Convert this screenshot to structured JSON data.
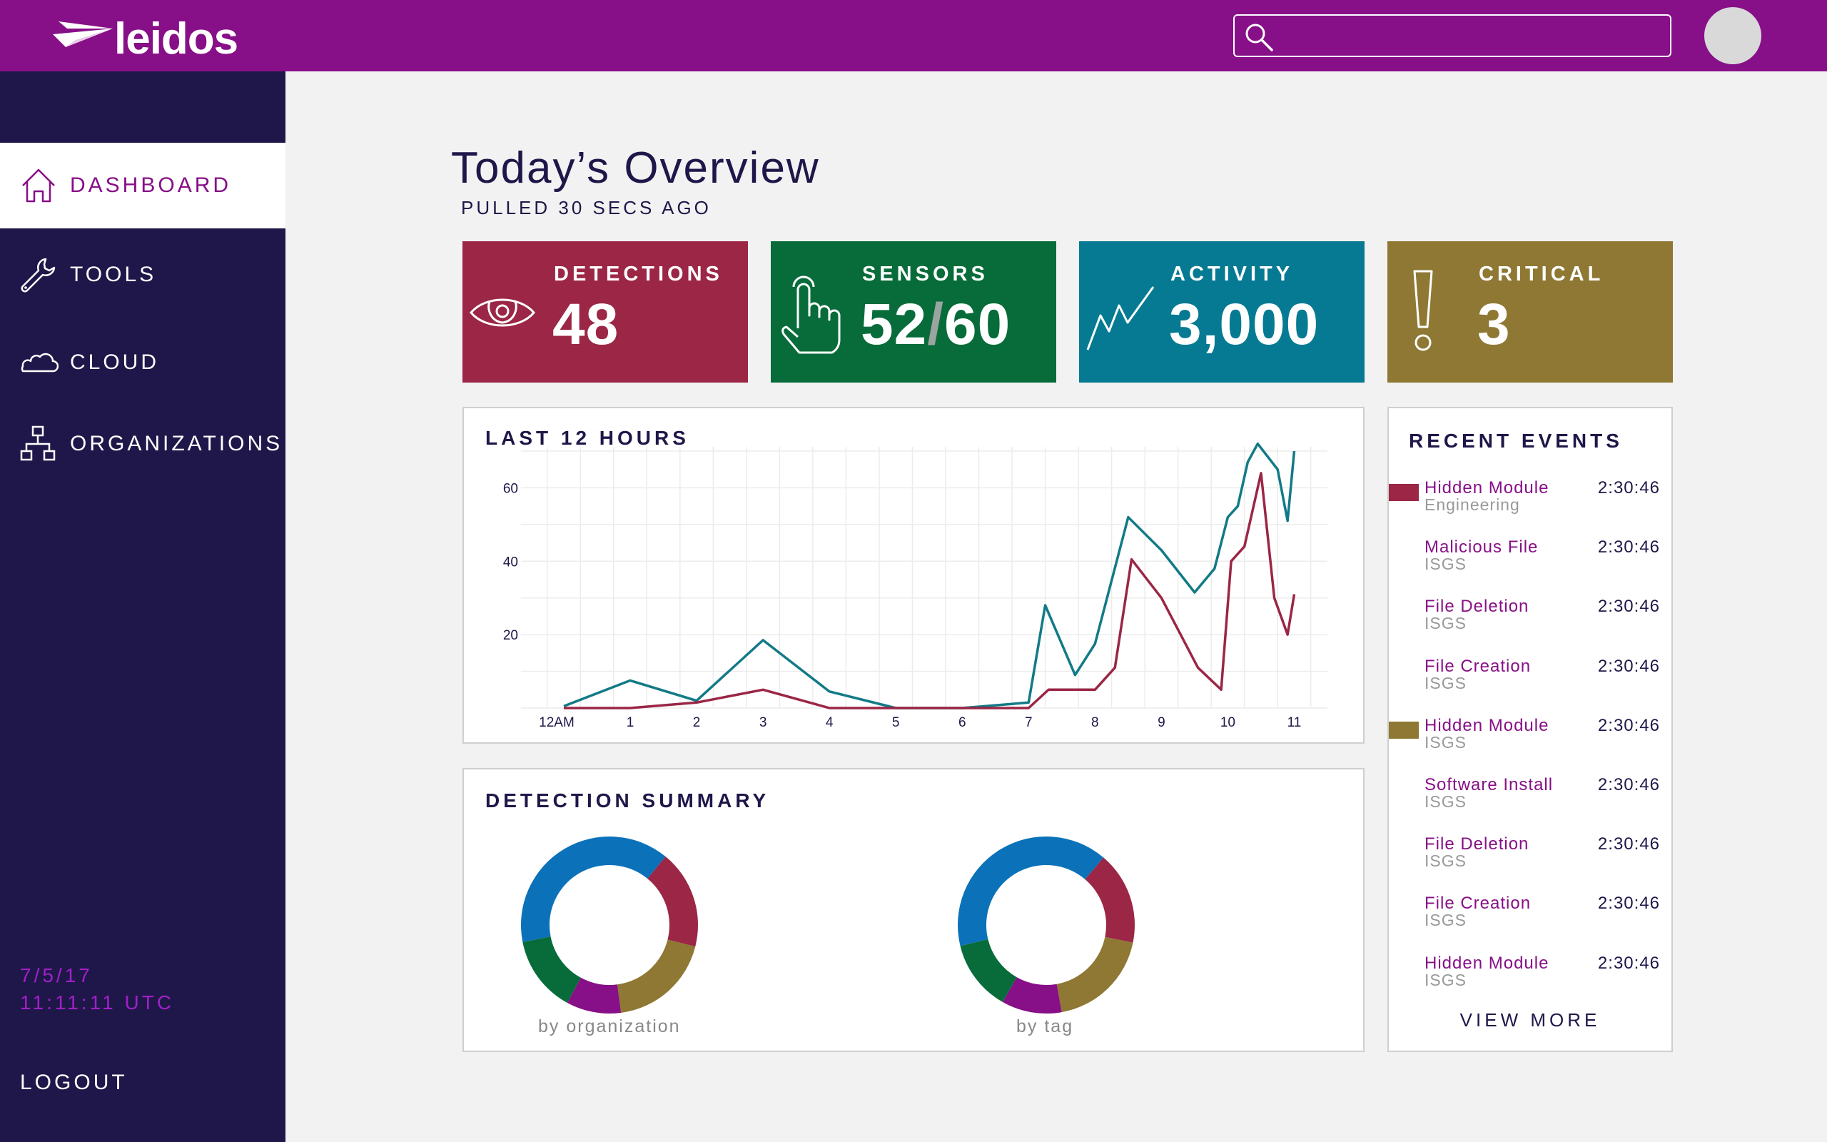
{
  "brand": {
    "name": "leidos"
  },
  "search": {
    "placeholder": ""
  },
  "sidebar": {
    "items": [
      {
        "label": "DASHBOARD",
        "icon": "home-icon"
      },
      {
        "label": "TOOLS",
        "icon": "wrench-icon"
      },
      {
        "label": "CLOUD",
        "icon": "cloud-icon"
      },
      {
        "label": "ORGANIZATIONS",
        "icon": "org-chart-icon"
      }
    ],
    "date": "7/5/17",
    "time": "11:11:11 UTC",
    "logout": "LOGOUT"
  },
  "overview": {
    "title": "Today’s Overview",
    "subtitle": "PULLED 30 SECS AGO"
  },
  "cards": {
    "detections": {
      "label": "DETECTIONS",
      "value": "48",
      "icon": "eye-icon",
      "color": "#9b2645"
    },
    "sensors": {
      "label": "SENSORS",
      "value_a": "52",
      "sep": "/",
      "value_b": "60",
      "icon": "pointer-hand-icon",
      "color": "#076c3a"
    },
    "activity": {
      "label": "ACTIVITY",
      "value": "3,000",
      "icon": "activity-line-icon",
      "color": "#067a92"
    },
    "critical": {
      "label": "CRITICAL",
      "value": "3",
      "icon": "exclamation-icon",
      "color": "#8e7833"
    }
  },
  "chart_panel": {
    "title": "LAST 12 HOURS"
  },
  "chart_data": {
    "type": "line",
    "title": "LAST 12 HOURS",
    "x_ticks": [
      "12AM",
      "1",
      "2",
      "3",
      "4",
      "5",
      "6",
      "7",
      "8",
      "9",
      "10",
      "11"
    ],
    "y_ticks": [
      20,
      40,
      60
    ],
    "ylim": [
      0,
      70
    ],
    "xlim": [
      0,
      11.5
    ],
    "grid": true,
    "series": [
      {
        "color": "#127a86",
        "x": [
          0,
          1,
          2,
          3,
          4,
          5,
          6,
          7,
          7.25,
          7.7,
          8,
          8.5,
          9,
          9.5,
          9.8,
          10,
          10.15,
          10.3,
          10.45,
          10.75,
          10.9,
          11
        ],
        "y": [
          0.5,
          7.5,
          2,
          18.5,
          4.5,
          0,
          0,
          1.5,
          28,
          9,
          17.5,
          52,
          43,
          31.5,
          38,
          52,
          55,
          67,
          72,
          65,
          51,
          70
        ]
      },
      {
        "color": "#9b2645",
        "x": [
          0,
          1,
          2,
          3,
          4,
          5,
          6,
          7,
          7.3,
          8,
          8.3,
          8.55,
          9,
          9.55,
          9.9,
          10.05,
          10.25,
          10.5,
          10.7,
          10.9,
          11
        ],
        "y": [
          0,
          0,
          1.5,
          5,
          0,
          0,
          0,
          0,
          5,
          5,
          11,
          40.5,
          30,
          11,
          5,
          40,
          44,
          64,
          30,
          20,
          31
        ]
      }
    ]
  },
  "summary": {
    "title": "DETECTION SUMMARY",
    "colors": [
      "#0b72b9",
      "#9b2645",
      "#8e7833",
      "#870f87",
      "#076c3a"
    ],
    "donuts": [
      {
        "label": "by organization",
        "values": [
          39,
          18,
          19,
          10,
          14
        ]
      },
      {
        "label": "by tag",
        "values": [
          40,
          17,
          19,
          11,
          13
        ]
      }
    ]
  },
  "events": {
    "title": "RECENT EVENTS",
    "view_more": "VIEW MORE",
    "items": [
      {
        "name": "Hidden Module",
        "org": "Engineering",
        "time": "2:30:46",
        "tag_color": "#9b2645"
      },
      {
        "name": "Malicious File",
        "org": "ISGS",
        "time": "2:30:46",
        "tag_color": ""
      },
      {
        "name": "File Deletion",
        "org": "ISGS",
        "time": "2:30:46",
        "tag_color": ""
      },
      {
        "name": "File Creation",
        "org": "ISGS",
        "time": "2:30:46",
        "tag_color": ""
      },
      {
        "name": "Hidden Module",
        "org": "ISGS",
        "time": "2:30:46",
        "tag_color": "#8e7833"
      },
      {
        "name": "Software Install",
        "org": "ISGS",
        "time": "2:30:46",
        "tag_color": ""
      },
      {
        "name": "File Deletion",
        "org": "ISGS",
        "time": "2:30:46",
        "tag_color": ""
      },
      {
        "name": "File Creation",
        "org": "ISGS",
        "time": "2:30:46",
        "tag_color": ""
      },
      {
        "name": "Hidden Module",
        "org": "ISGS",
        "time": "2:30:46",
        "tag_color": ""
      }
    ]
  }
}
